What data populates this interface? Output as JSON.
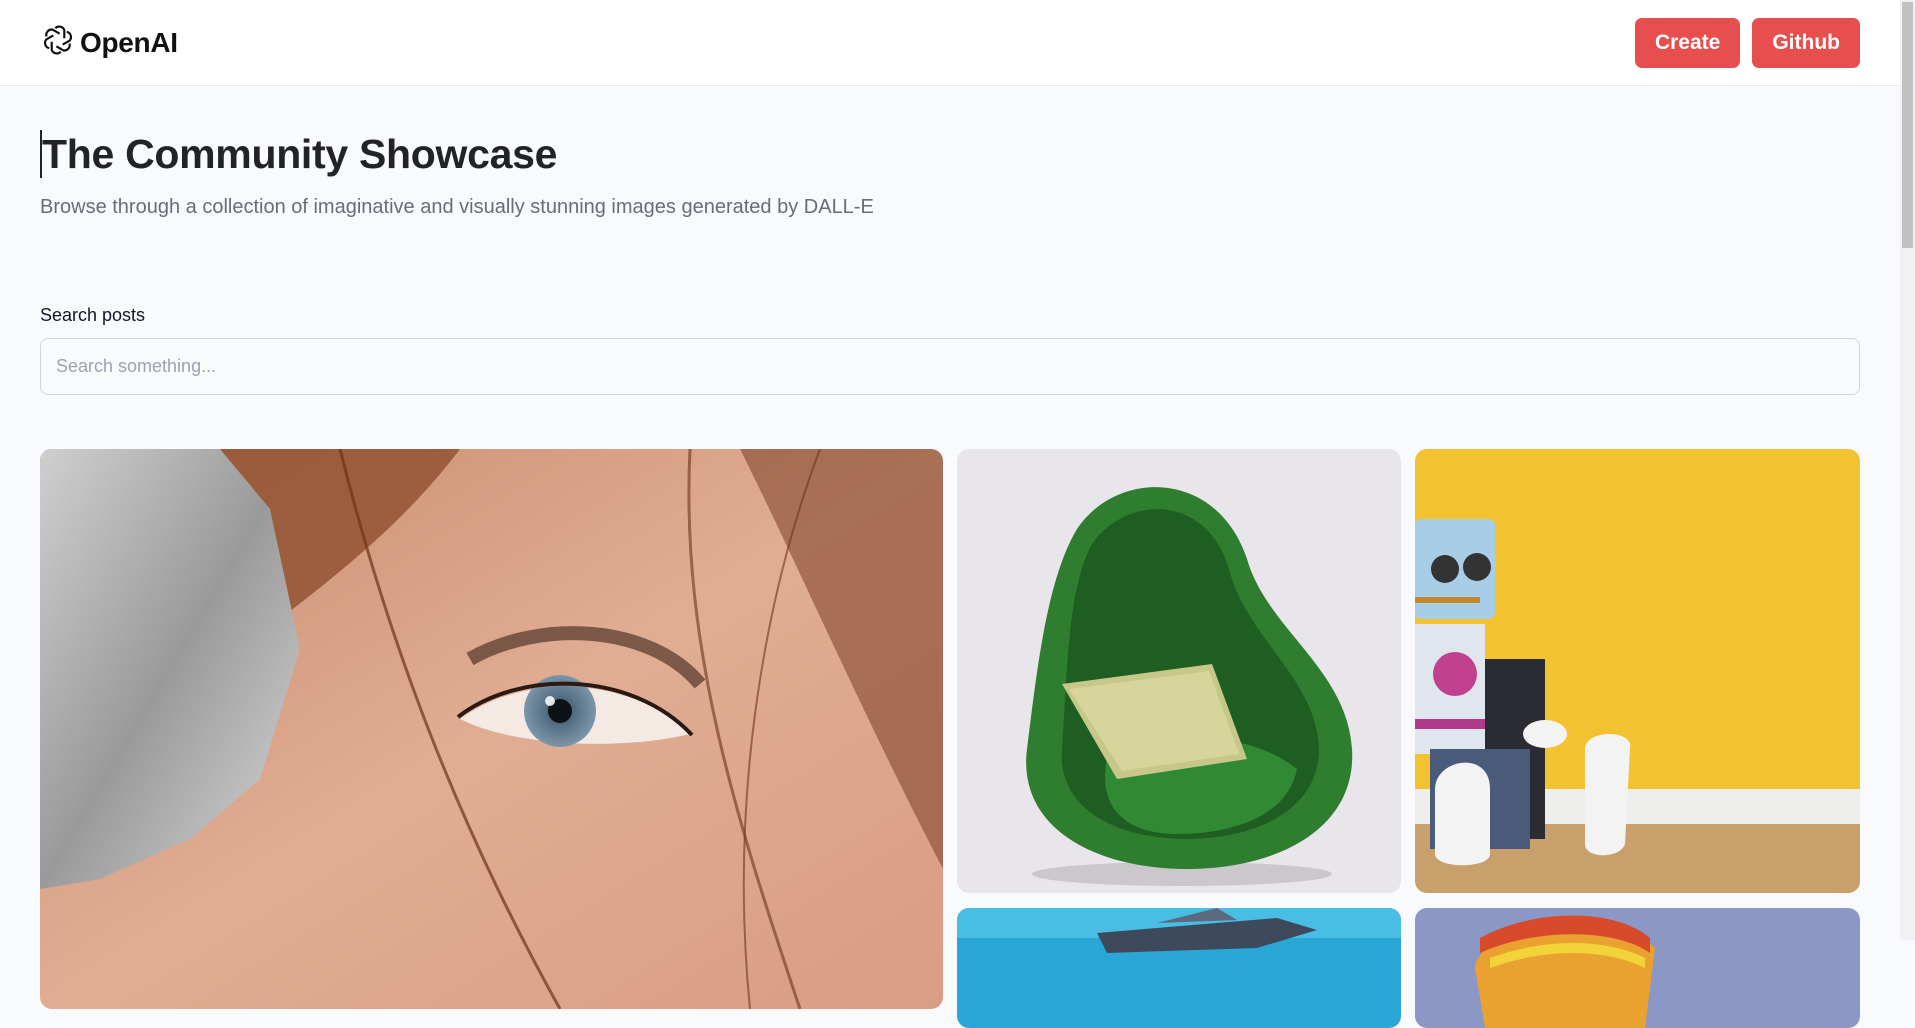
{
  "header": {
    "logo_text": "OpenAI",
    "logo_icon": "openai-logo-icon",
    "nav": {
      "create_label": "Create",
      "github_label": "Github"
    }
  },
  "main": {
    "title": "The Community Showcase",
    "subtitle": "Browse through a collection of imaginative and visually stunning images generated by DALL-E",
    "search": {
      "label": "Search posts",
      "placeholder": "Search something...",
      "value": ""
    }
  },
  "gallery": {
    "cards": [
      {
        "name": "close-up-eye-image"
      },
      {
        "name": "green-chair-image"
      },
      {
        "name": "toy-robot-image"
      },
      {
        "name": "spaceship-image"
      },
      {
        "name": "balloon-image"
      }
    ]
  },
  "colors": {
    "accent": "#e74e4e",
    "background": "#f9fafe",
    "title": "#222328",
    "subtitle": "#666e75"
  }
}
